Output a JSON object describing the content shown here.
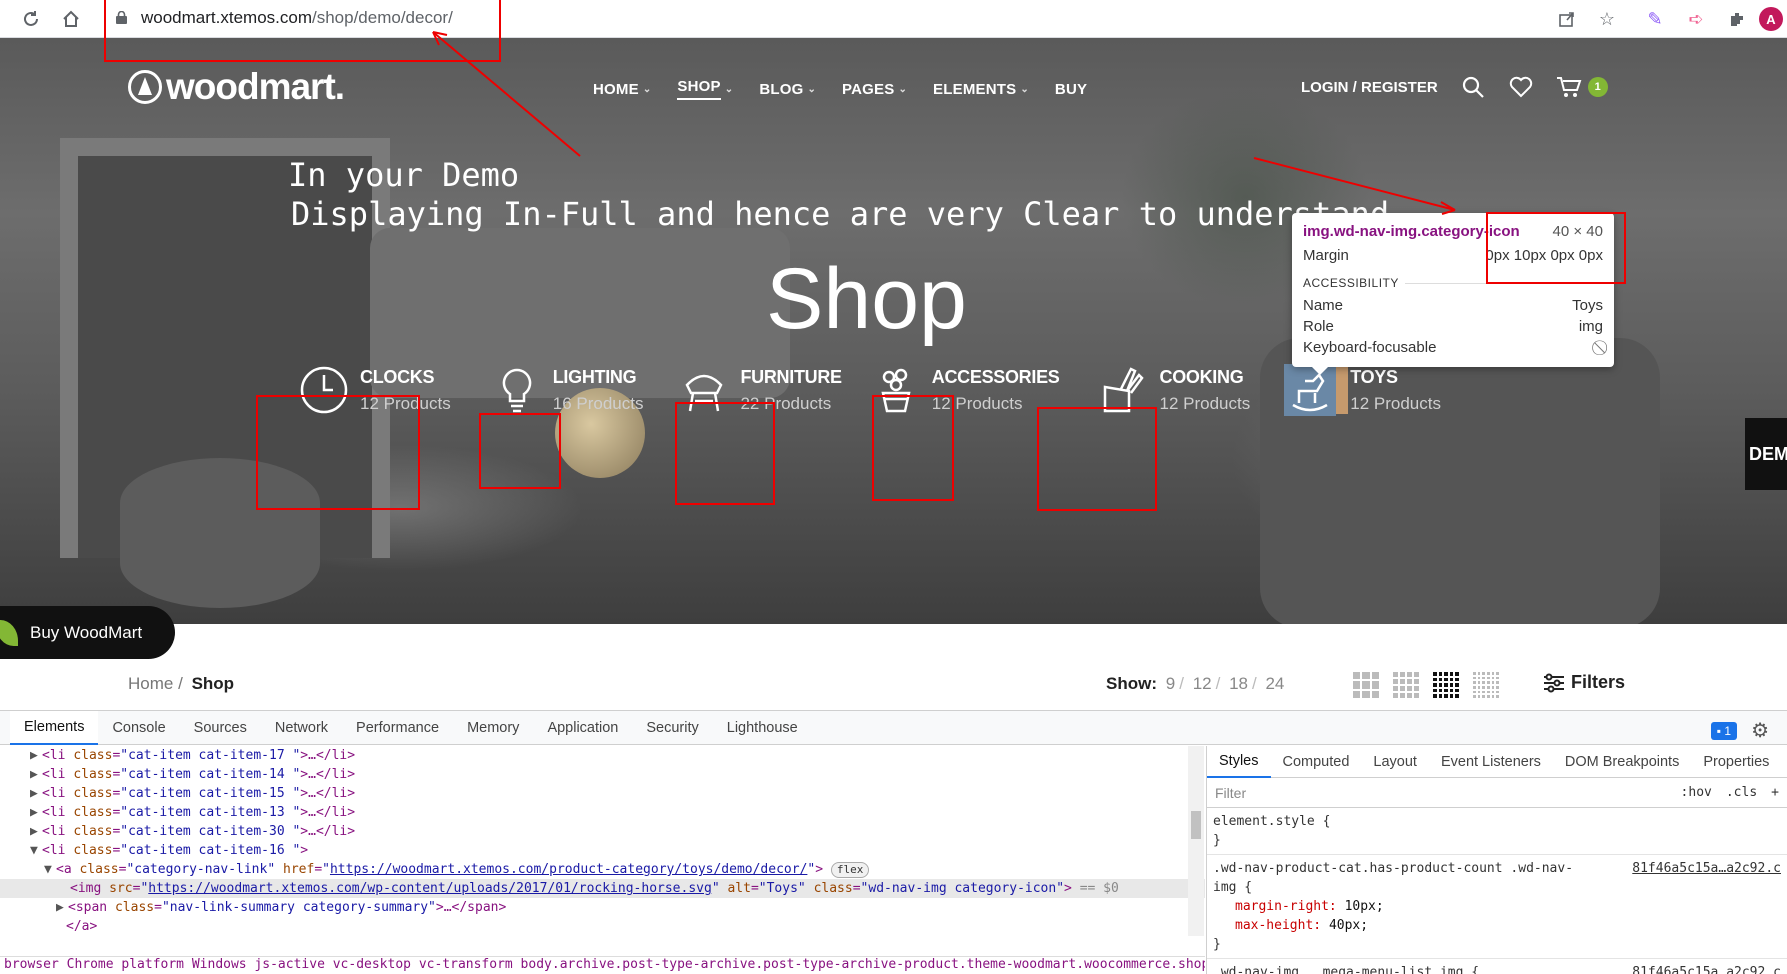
{
  "browser": {
    "url_domain": "woodmart.xtemos.com",
    "url_path": "/shop/demo/decor/",
    "avatar_letter": "A"
  },
  "header": {
    "logo": "woodmart.",
    "nav": [
      {
        "label": "HOME",
        "dropdown": true
      },
      {
        "label": "SHOP",
        "dropdown": true,
        "active": true
      },
      {
        "label": "BLOG",
        "dropdown": true
      },
      {
        "label": "PAGES",
        "dropdown": true
      },
      {
        "label": "ELEMENTS",
        "dropdown": true
      },
      {
        "label": "BUY",
        "dropdown": false
      }
    ],
    "login": "LOGIN / REGISTER",
    "cart_count": "1"
  },
  "hero": {
    "overlay_line1": "In your Demo",
    "overlay_line2": "Displaying In-Full and hence are very Clear to understand",
    "title": "Shop",
    "side_tab": "DEM",
    "categories": [
      {
        "name": "CLOCKS",
        "count": "12 Products",
        "icon": "clock-icon"
      },
      {
        "name": "LIGHTING",
        "count": "16 Products",
        "icon": "lightbulb-icon"
      },
      {
        "name": "FURNITURE",
        "count": "22 Products",
        "icon": "chair-icon"
      },
      {
        "name": "ACCESSORIES",
        "count": "12 Products",
        "icon": "flower-pot-icon"
      },
      {
        "name": "COOKING",
        "count": "12 Products",
        "icon": "knife-block-icon"
      },
      {
        "name": "TOYS",
        "count": "12 Products",
        "icon": "rocking-horse-icon"
      }
    ]
  },
  "inspect_tooltip": {
    "selector": "img.wd-nav-img.category-icon",
    "size": "40 × 40",
    "margin_label": "Margin",
    "margin_value": "0px 10px 0px 0px",
    "section": "ACCESSIBILITY",
    "name_label": "Name",
    "name_value": "Toys",
    "role_label": "Role",
    "role_value": "img",
    "keyboard_label": "Keyboard-focusable"
  },
  "buy_button": "Buy WoodMart",
  "shop_bar": {
    "breadcrumb_home": "Home",
    "breadcrumb_sep": "/",
    "breadcrumb_current": "Shop",
    "show_label": "Show",
    "show_options": [
      "9",
      "12",
      "18",
      "24"
    ],
    "filters": "Filters"
  },
  "devtools": {
    "tabs": [
      "Elements",
      "Console",
      "Sources",
      "Network",
      "Performance",
      "Memory",
      "Application",
      "Security",
      "Lighthouse"
    ],
    "issues_count": "1",
    "dom": {
      "cat17": "\"cat-item cat-item-17 \"",
      "cat14": "\"cat-item cat-item-14 \"",
      "cat15": "\"cat-item cat-item-15 \"",
      "cat13": "\"cat-item cat-item-13 \"",
      "cat30": "\"cat-item cat-item-30 \"",
      "cat16": "\"cat-item cat-item-16 \"",
      "a_class": "\"category-nav-link\"",
      "a_href": "https://woodmart.xtemos.com/product-category/toys/demo/decor/",
      "img_src": "https://woodmart.xtemos.com/wp-content/uploads/2017/01/rocking-horse.svg",
      "img_alt": "\"Toys\"",
      "img_class": "\"wd-nav-img category-icon\"",
      "span_class": "\"nav-link-summary category-summary\"",
      "flex": "flex",
      "eq": "== $0"
    },
    "crumbs": "browser Chrome platform Windows js-active vc-desktop vc-transform    body.archive.post-type-archive.post-type-archive-product.theme-woodmart.woocommerce.shop.wooco",
    "styles_tabs": [
      "Styles",
      "Computed",
      "Layout",
      "Event Listeners",
      "DOM Breakpoints",
      "Properties"
    ],
    "filter_placeholder": "Filter",
    "hov": ":hov",
    "cls": ".cls",
    "rule1_selector": "element.style {",
    "rule2_selector": ".wd-nav-product-cat.has-product-count .wd-nav-img {",
    "rule2_src": "81f46a5c15a…a2c92.c",
    "rule2_prop1": "margin-right",
    "rule2_val1": "10px;",
    "rule2_prop2": "max-height",
    "rule2_val2": "40px;",
    "rule3_selector": ".wd-nav-img, .mega-menu-list img {",
    "rule3_src": "81f46a5c15a…a2c92.c"
  }
}
